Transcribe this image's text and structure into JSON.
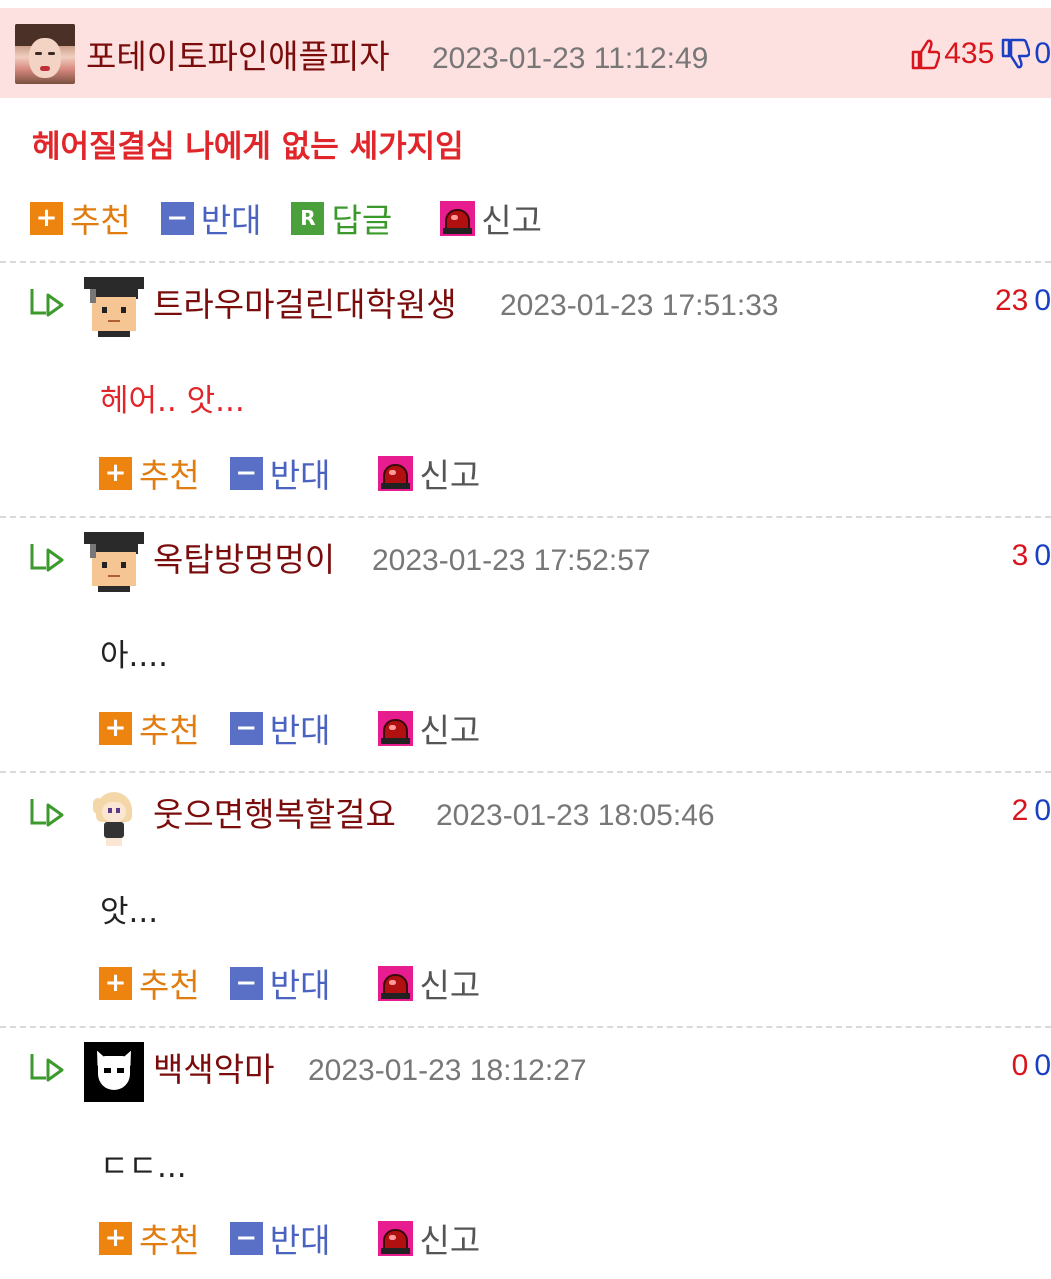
{
  "labels": {
    "recommend": "추천",
    "oppose": "반대",
    "reply": "답글",
    "report": "신고",
    "reply_icon": "R"
  },
  "colors": {
    "header_bg": "#fde0e0",
    "nickname": "#7a0c0c",
    "upvote": "#d8141c",
    "downvote": "#1b3fc2",
    "body_highlight": "#e0262a"
  },
  "main_comment": {
    "nickname": "포테이토파인애플피자",
    "timestamp": "2023-01-23 11:12:49",
    "upvotes": "435",
    "downvotes": "0",
    "body": "헤어질결심 나에게 없는 세가지임",
    "avatar_icon": "profile-photo"
  },
  "replies": [
    {
      "nickname": "트라우마걸린대학원생",
      "timestamp": "2023-01-23 17:51:33",
      "upvotes": "23",
      "downvotes": "0",
      "body": "헤어.. 앗...",
      "avatar_icon": "graduate-avatar"
    },
    {
      "nickname": "옥탑방멍멍이",
      "timestamp": "2023-01-23 17:52:57",
      "upvotes": "3",
      "downvotes": "0",
      "body": "아....",
      "avatar_icon": "graduate-avatar"
    },
    {
      "nickname": "웃으면행복할걸요",
      "timestamp": "2023-01-23 18:05:46",
      "upvotes": "2",
      "downvotes": "0",
      "body": "앗...",
      "avatar_icon": "anime-girl-avatar"
    },
    {
      "nickname": "백색악마",
      "timestamp": "2023-01-23 18:12:27",
      "upvotes": "0",
      "downvotes": "0",
      "body": "ㄷㄷ...",
      "avatar_icon": "white-devil-avatar"
    }
  ]
}
